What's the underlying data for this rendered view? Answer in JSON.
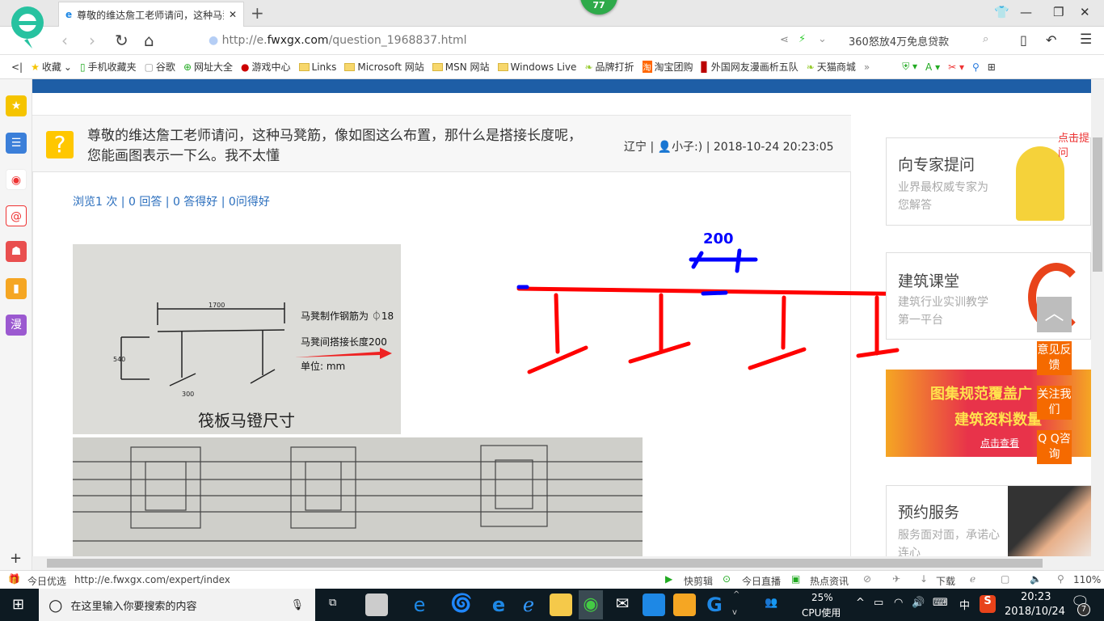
{
  "browser": {
    "tab_title": "尊敬的维达詹工老师请问，这种马凳筋",
    "badge": "77",
    "url_prefix": "http://e.",
    "url_domain": "fwxgx.com",
    "url_path": "/question_1968837.html",
    "search_ad": "360怒放4万免息贷款",
    "bookmarks": [
      "收藏",
      "手机收藏夹",
      "谷歌",
      "网址大全",
      "游戏中心",
      "Links",
      "Microsoft 网站",
      "MSN 网站",
      "Windows Live",
      "品牌打折",
      "淘宝团购",
      "外国网友漫画析五队",
      "天猫商城"
    ],
    "more": "»"
  },
  "sidebar_icons": [
    "star-icon",
    "list-icon",
    "weibo-icon",
    "mail-icon",
    "game-icon",
    "book-icon",
    "comic-icon"
  ],
  "sidebar_comic_label": "漫",
  "sidebar_add": "+",
  "question": {
    "title": "尊敬的维达詹工老师请问，这种马凳筋，像如图这么布置，那什么是搭接长度呢，您能画图表示一下么。我不太懂",
    "location": "辽宁",
    "user": "小子:)",
    "datetime": "2018-10-24 20:23:05",
    "stats": "浏览1 次 | 0 回答 | 0 答得好 | 0问得好"
  },
  "photo": {
    "dim_top": "1700",
    "dim_side": "540",
    "dim_foot": "300",
    "note1": "马凳制作钢筋为 ⏀18",
    "note2": "马凳间搭接长度200",
    "note3": "单位: mm",
    "caption": "筏板马镫尺寸"
  },
  "sketch": {
    "label": "200",
    "line_color": "#ff0000",
    "mark_color": "#0000ff"
  },
  "right": {
    "cards": [
      {
        "title": "向专家提问",
        "sub": "业界最权威专家为您解答",
        "bubble": "点击提问"
      },
      {
        "title": "建筑课堂",
        "sub": "建筑行业实训教学第一平台"
      },
      {
        "title": "预约服务",
        "sub": "服务面对面，承诺心连心"
      }
    ],
    "banner": {
      "line1": "图集规范覆盖广",
      "line2": "建筑资料数量",
      "link": "点击查看"
    },
    "float": [
      "意见反馈",
      "关注我们",
      "Q Q咨询"
    ]
  },
  "status": {
    "left_label": "今日优选",
    "hover_url": "http://e.fwxgx.com/expert/index",
    "items": [
      "快剪辑",
      "今日直播",
      "热点资讯",
      "下载"
    ],
    "zoom": "110%"
  },
  "taskbar": {
    "search_placeholder": "在这里输入你要搜索的内容",
    "cpu_pct": "25%",
    "cpu_label": "CPU使用",
    "ime": "中",
    "time": "20:23",
    "date": "2018/10/24",
    "notifications": "7"
  }
}
